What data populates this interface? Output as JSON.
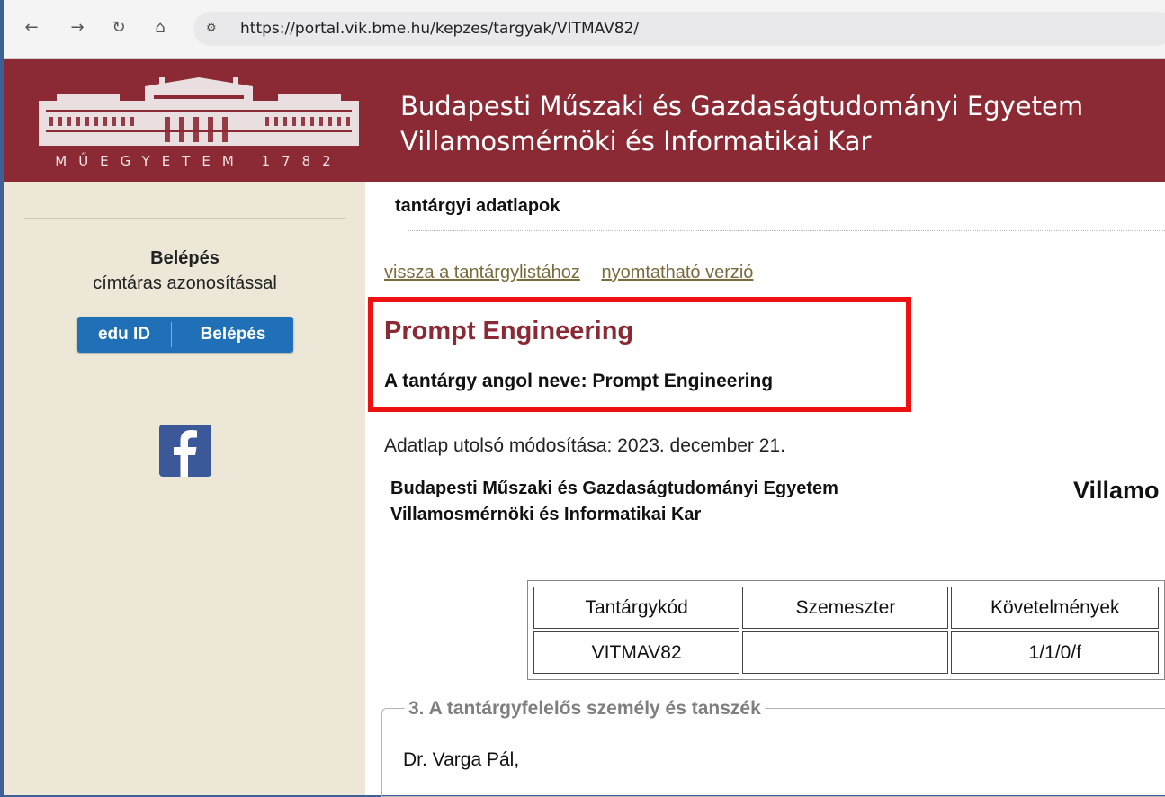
{
  "browser": {
    "url": "https://portal.vik.bme.hu/kepzes/targyak/VITMAV82/",
    "back_icon": "arrow-left",
    "forward_icon": "arrow-right",
    "reload_icon": "reload",
    "home_icon": "home",
    "site_info_icon": "tune"
  },
  "header": {
    "logo_text": "MŰEGYETEM 1782",
    "university": "Budapesti Műszaki és Gazdaságtudományi Egyetem",
    "faculty": "Villamosmérnöki és Informatikai Kar",
    "brand_color": "#8b2a35"
  },
  "sidebar": {
    "login_title": "Belépés",
    "login_subtitle": "címtáras azonosítással",
    "eduid_logo": "edu ID",
    "eduid_button": "Belépés",
    "facebook_icon": "f"
  },
  "main": {
    "section_title": "tantárgyi adatlapok",
    "links": [
      "vissza a tantárgylistához",
      "nyomtatható verzió"
    ],
    "course_title": "Prompt Engineering",
    "english_name": "A tantárgy angol neve: Prompt Engineering",
    "modified": "Adatlap utolsó módosítása: 2023. december 21.",
    "university": "Budapesti Műszaki és Gazdaságtudományi Egyetem",
    "faculty": "Villamosmérnöki és Informatikai Kar",
    "right_heading": "Villamo",
    "table": {
      "headers": [
        "Tantárgykód",
        "Szemeszter",
        "Követelmények"
      ],
      "row": [
        "VITMAV82",
        "",
        "1/1/0/f"
      ]
    },
    "responsible_legend": "3. A tantárgyfelelős személy és tanszék",
    "responsible_person": "Dr. Varga Pál,"
  }
}
